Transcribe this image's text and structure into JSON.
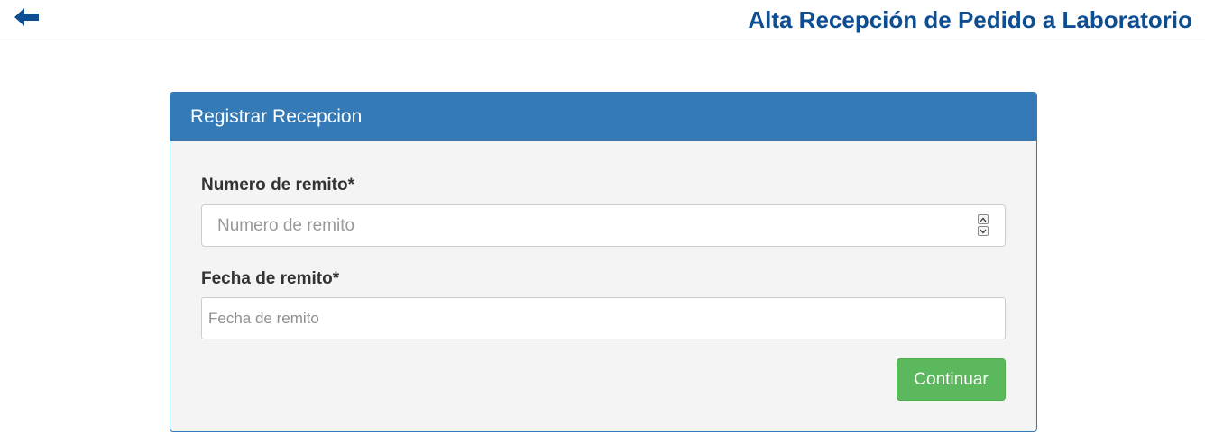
{
  "header": {
    "back_icon": "arrow-left-icon",
    "title": "Alta Recepción de Pedido a Laboratorio",
    "title_color": "#0d4d91"
  },
  "panel": {
    "heading": "Registrar Recepcion",
    "heading_color": "#337ab7",
    "fields": [
      {
        "label": "Numero de remito*",
        "placeholder": "Numero de remito",
        "value": "",
        "type": "number"
      },
      {
        "label": "Fecha de remito*",
        "placeholder": "Fecha de remito",
        "value": "",
        "type": "text"
      }
    ],
    "submit_label": "Continuar",
    "submit_color": "#5cb85c"
  }
}
